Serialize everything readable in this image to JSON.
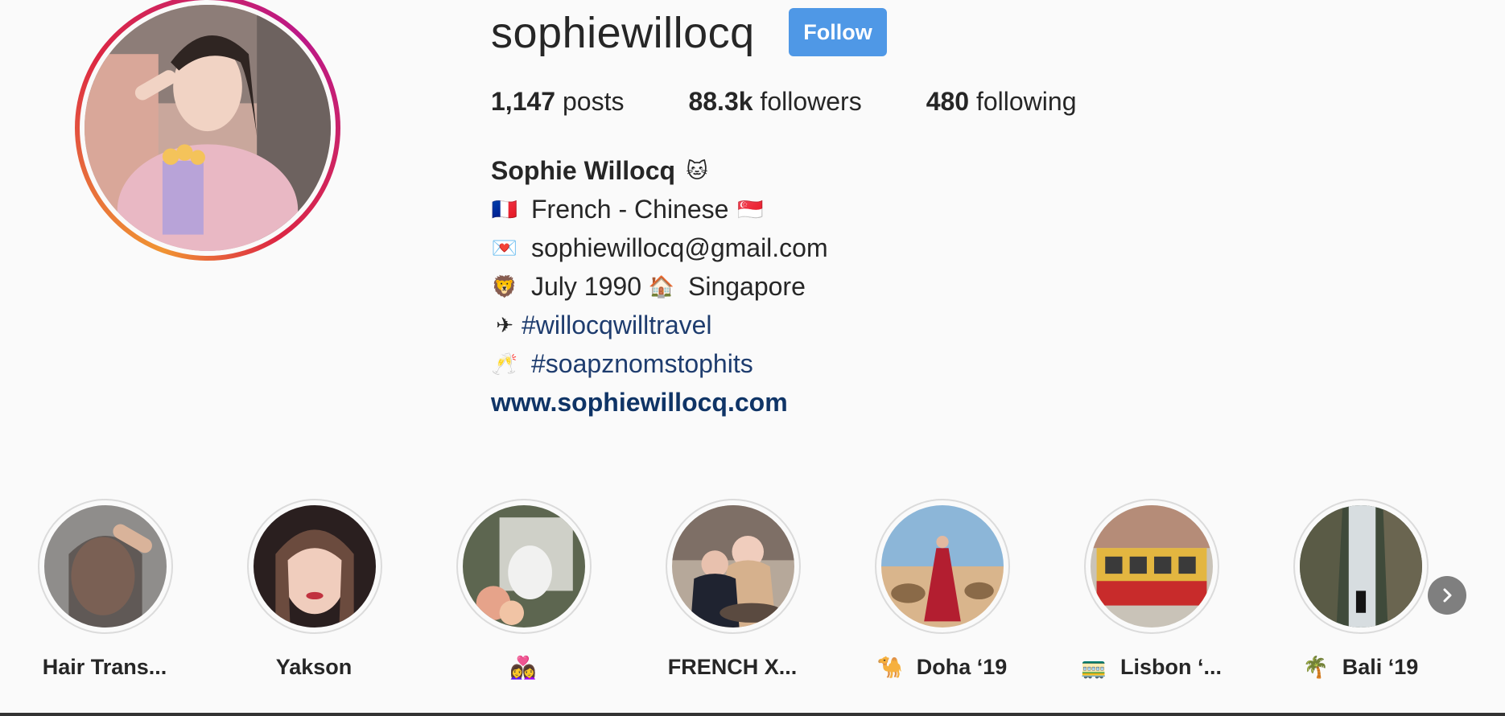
{
  "profile": {
    "username": "sophiewillocq",
    "follow_label": "Follow",
    "stats": {
      "posts_count": "1,147",
      "posts_label": "posts",
      "followers_count": "88.3k",
      "followers_label": "followers",
      "following_count": "480",
      "following_label": "following"
    },
    "bio": {
      "full_name": "Sophie Willocq",
      "name_emoji": "🐱",
      "line1_emoji": "🇫🇷",
      "line1_text": "French - Chinese",
      "line1_flag": "🇸🇬",
      "line2_emoji": "💌",
      "line2_text": "sophiewillocq@gmail.com",
      "line3_emoji": "🦁",
      "line3_text_a": "July 1990",
      "line3_emoji_b": "🏠",
      "line3_text_b": "Singapore",
      "line4_emoji": "✈",
      "line4_tag": "#willocqwilltravel",
      "line5_emoji": "🥂",
      "line5_tag": "#soapznomstophits",
      "website": "www.sophiewillocq.com"
    }
  },
  "highlights": [
    {
      "emoji": "",
      "title": "Hair Trans..."
    },
    {
      "emoji": "",
      "title": "Yakson"
    },
    {
      "emoji": "👩‍❤️‍👩",
      "title": ""
    },
    {
      "emoji": "",
      "title": "FRENCH X..."
    },
    {
      "emoji": "🐪",
      "title": "Doha ‘19"
    },
    {
      "emoji": "🚃",
      "title": "Lisbon ‘..."
    },
    {
      "emoji": "🌴",
      "title": "Bali ‘19"
    }
  ],
  "icons": {
    "next": "chevron-right-icon"
  },
  "colors": {
    "follow_button": "#4f98e6",
    "hashtag": "#1e3c6e",
    "website": "#0f3466",
    "ring_gradient": [
      "#f09433",
      "#dc2743",
      "#bc1888"
    ]
  }
}
